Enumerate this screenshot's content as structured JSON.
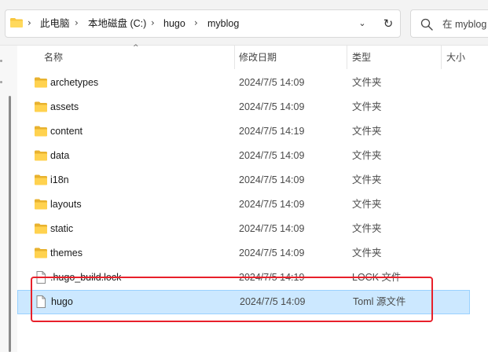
{
  "breadcrumb": {
    "items": [
      "此电脑",
      "本地磁盘 (C:)",
      "hugo",
      "myblog"
    ]
  },
  "search": {
    "placeholder": "在 myblog 中搜索",
    "visible_text": "在 myblog"
  },
  "columns": {
    "name": "名称",
    "date": "修改日期",
    "type": "类型",
    "size": "大小"
  },
  "files": [
    {
      "name": "archetypes",
      "date": "2024/7/5 14:09",
      "type": "文件夹",
      "icon": "folder-icon"
    },
    {
      "name": "assets",
      "date": "2024/7/5 14:09",
      "type": "文件夹",
      "icon": "folder-icon"
    },
    {
      "name": "content",
      "date": "2024/7/5 14:19",
      "type": "文件夹",
      "icon": "folder-icon"
    },
    {
      "name": "data",
      "date": "2024/7/5 14:09",
      "type": "文件夹",
      "icon": "folder-icon"
    },
    {
      "name": "i18n",
      "date": "2024/7/5 14:09",
      "type": "文件夹",
      "icon": "folder-icon"
    },
    {
      "name": "layouts",
      "date": "2024/7/5 14:09",
      "type": "文件夹",
      "icon": "folder-icon"
    },
    {
      "name": "static",
      "date": "2024/7/5 14:09",
      "type": "文件夹",
      "icon": "folder-icon"
    },
    {
      "name": "themes",
      "date": "2024/7/5 14:09",
      "type": "文件夹",
      "icon": "folder-icon"
    },
    {
      "name": ".hugo_build.lock",
      "date": "2024/7/5 14:19",
      "type": "LOCK 文件",
      "icon": "file-icon"
    },
    {
      "name": "hugo",
      "date": "2024/7/5 14:09",
      "type": "Toml 源文件",
      "icon": "file-icon",
      "selected": true
    }
  ],
  "colors": {
    "selection_bg": "#cce8ff",
    "selection_border": "#99d1ff",
    "highlight_annotation": "#e8202a",
    "folder_yellow": "#f8c73e"
  }
}
